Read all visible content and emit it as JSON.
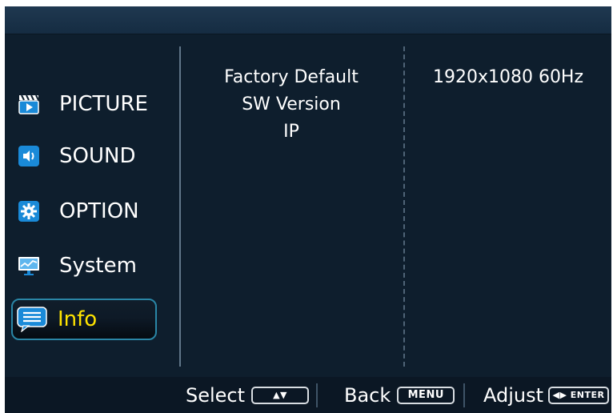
{
  "menu": {
    "items": [
      {
        "label": "PICTURE",
        "icon": "clapperboard-icon"
      },
      {
        "label": "SOUND",
        "icon": "speaker-icon"
      },
      {
        "label": "OPTION",
        "icon": "gear-icon"
      },
      {
        "label": "System",
        "icon": "monitor-chart-icon"
      },
      {
        "label": "Info",
        "icon": "speech-bubble-icon",
        "selected": true
      }
    ]
  },
  "submenu": {
    "items": [
      "Factory Default",
      "SW Version",
      "IP"
    ]
  },
  "value": {
    "resolution": "1920x1080 60Hz"
  },
  "bottom_bar": {
    "select_label": "Select",
    "select_key": "▲▼",
    "back_label": "Back",
    "back_key": "MENU",
    "adjust_label": "Adjust",
    "adjust_key": "◀▶ ENTER"
  },
  "colors": {
    "background": "#0e1e2d",
    "selected_text": "#ffe400",
    "selected_border": "#2a86a6",
    "icon_blue": "#1a8ad8"
  }
}
